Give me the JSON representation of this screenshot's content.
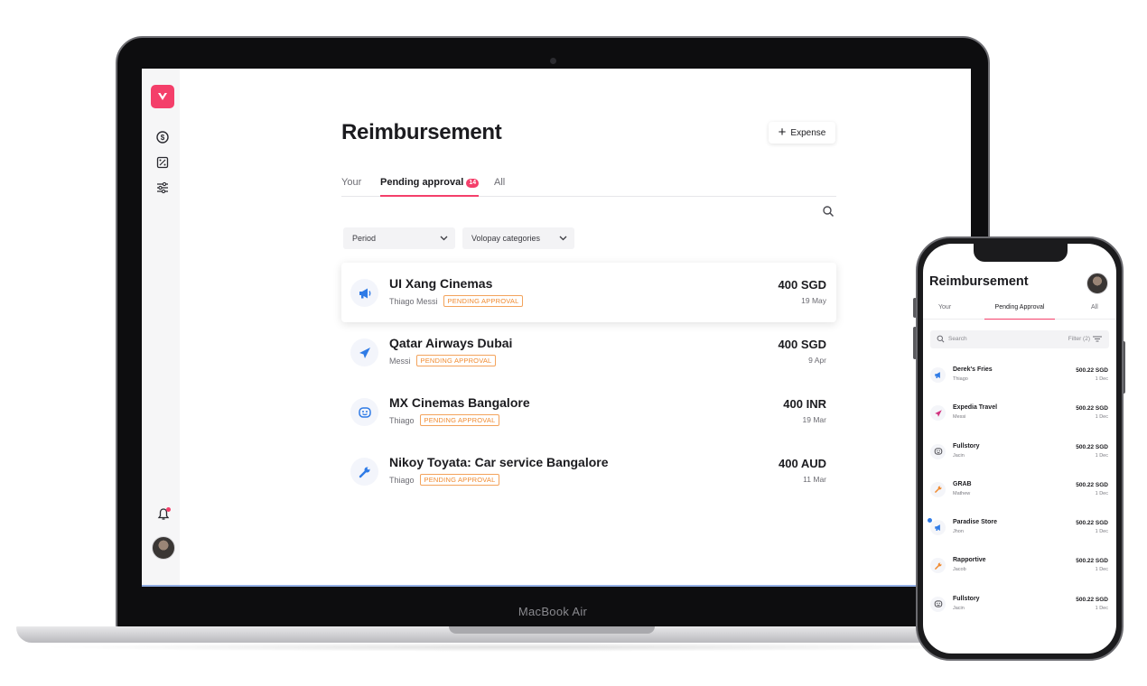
{
  "laptop": {
    "brand_label": "MacBook Air",
    "sidebar": {
      "items": [
        {
          "icon": "dollar-circle-icon"
        },
        {
          "icon": "percent-card-icon"
        },
        {
          "icon": "sliders-icon"
        }
      ],
      "notification_icon": "bell-icon",
      "avatar_alt": "user-avatar"
    },
    "header": {
      "title": "Reimbursement",
      "expense_button_label": "Expense"
    },
    "tabs": [
      {
        "label": "Your",
        "active": false
      },
      {
        "label": "Pending approval",
        "active": true,
        "badge": "14"
      },
      {
        "label": "All",
        "active": false
      }
    ],
    "filters": [
      {
        "label": "Period"
      },
      {
        "label": "Volopay categories"
      }
    ],
    "expenses": [
      {
        "merchant": "UI Xang Cinemas",
        "person": "Thiago Messi",
        "status": "PENDING APPROVAL",
        "amount": "400 SGD",
        "date": "19 May",
        "icon": "megaphone-icon",
        "selected": true
      },
      {
        "merchant": "Qatar Airways Dubai",
        "person": "Messi",
        "status": "PENDING APPROVAL",
        "amount": "400 SGD",
        "date": "9 Apr",
        "icon": "airplane-icon",
        "selected": false
      },
      {
        "merchant": "MX Cinemas Bangalore",
        "person": "Thiago",
        "status": "PENDING APPROVAL",
        "amount": "400 INR",
        "date": "19 Mar",
        "icon": "smiley-icon",
        "selected": false
      },
      {
        "merchant": "Nikoy Toyata: Car service  Bangalore",
        "person": "Thiago",
        "status": "PENDING APPROVAL",
        "amount": "400 AUD",
        "date": "11 Mar",
        "icon": "wrench-icon",
        "selected": false
      }
    ],
    "colors": {
      "accent": "#f43f6a",
      "icon_blue": "#2f7be6",
      "pending_orange": "#f08a2f"
    }
  },
  "phone": {
    "title": "Reimbursement",
    "tabs": [
      {
        "label": "Your",
        "active": false
      },
      {
        "label": "Pending Approval",
        "active": true
      },
      {
        "label": "All",
        "active": false
      }
    ],
    "search_placeholder": "Search",
    "filter_label": "Filter (2)",
    "expenses": [
      {
        "merchant": "Derek's Fries",
        "person": "Thiago",
        "amount": "500.22 SGD",
        "date": "1 Dec",
        "icon": "megaphone-icon",
        "icon_color": "#2f7be6",
        "unread": false
      },
      {
        "merchant": "Expedia Travel",
        "person": "Messi",
        "amount": "500.22 SGD",
        "date": "1 Dec",
        "icon": "airplane-icon",
        "icon_color": "#d1337f",
        "unread": false
      },
      {
        "merchant": "Fullstory",
        "person": "Jacin",
        "amount": "500.22 SGD",
        "date": "1 Dec",
        "icon": "smiley-icon",
        "icon_color": "#4a4a50",
        "unread": false
      },
      {
        "merchant": "GRAB",
        "person": "Mathew",
        "amount": "500.22 SGD",
        "date": "1 Dec",
        "icon": "wrench-icon",
        "icon_color": "#f08a2f",
        "unread": false
      },
      {
        "merchant": "Paradise Store",
        "person": "Jhon",
        "amount": "500.22 SGD",
        "date": "1 Dec",
        "icon": "megaphone-icon",
        "icon_color": "#2f7be6",
        "unread": true
      },
      {
        "merchant": "Rapportive",
        "person": "Jacob",
        "amount": "500.22 SGD",
        "date": "1 Dec",
        "icon": "wrench-icon",
        "icon_color": "#f08a2f",
        "unread": false
      },
      {
        "merchant": "Fullstory",
        "person": "Jacin",
        "amount": "500.22 SGD",
        "date": "1 Dec",
        "icon": "smiley-icon",
        "icon_color": "#4a4a50",
        "unread": false
      }
    ]
  }
}
